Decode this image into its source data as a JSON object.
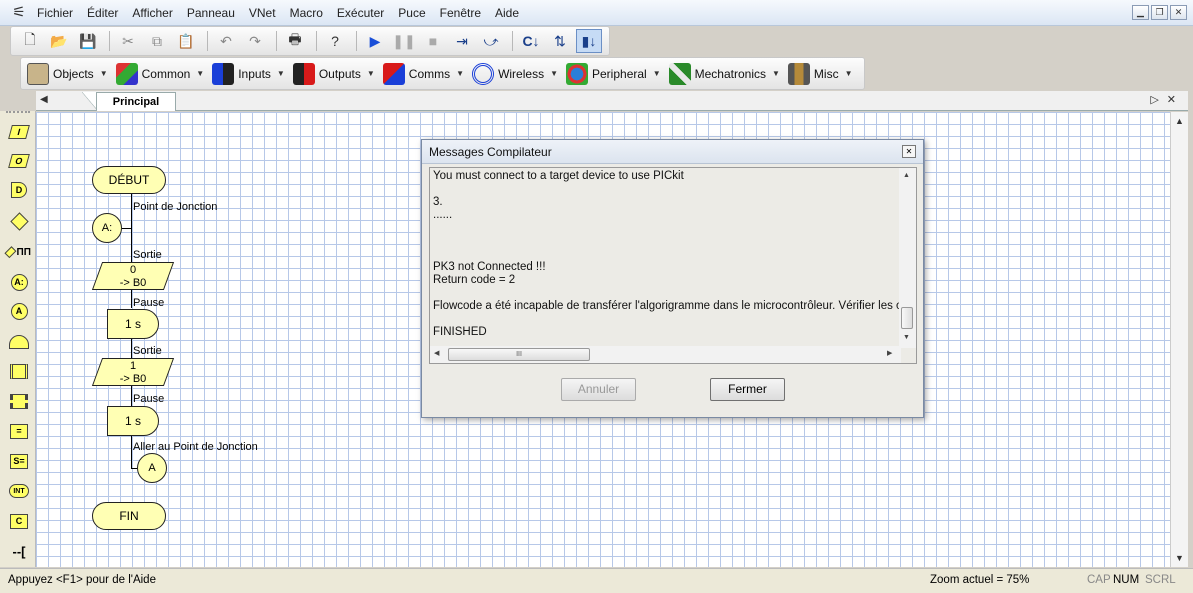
{
  "menubar": {
    "items": [
      "Fichier",
      "Éditer",
      "Afficher",
      "Panneau",
      "VNet",
      "Macro",
      "Exécuter",
      "Puce",
      "Fenêtre",
      "Aide"
    ]
  },
  "components_toolbar": {
    "groups": [
      "Objects",
      "Common",
      "Inputs",
      "Outputs",
      "Comms",
      "Wireless",
      "Peripheral",
      "Mechatronics",
      "Misc"
    ]
  },
  "tab": {
    "label": "Principal"
  },
  "flowchart": {
    "start": "DÉBUT",
    "end": "FIN",
    "junction_label": "Point de Jonction",
    "junction_name": "A:",
    "output1_label": "Sortie",
    "output1_value": "0",
    "output1_target": "-> B0",
    "pause1_label": "Pause",
    "pause1_value": "1 s",
    "output2_label": "Sortie",
    "output2_value": "1",
    "output2_target": "-> B0",
    "pause2_label": "Pause",
    "pause2_value": "1 s",
    "goto_label": "Aller au Point de Jonction",
    "goto_name": "A"
  },
  "dialog": {
    "title": "Messages Compilateur",
    "messages": "You must connect to a target device to use PICkit\n\n3.\n......\n\n\n\nPK3 not Connected !!!\nReturn code = 2\n\nFlowcode a été incapable de transférer l'algorigramme dans le microcontrôleur. Vérifier les options du\n\nFINISHED",
    "cancel_label": "Annuler",
    "close_label": "Fermer"
  },
  "statusbar": {
    "help": "Appuyez <F1> pour de l'Aide",
    "zoom": "Zoom actuel = 75%",
    "cap": "CAP",
    "num": "NUM",
    "scrl": "SCRL"
  },
  "colors": {
    "flow_fill": "#ffffb4",
    "grid": "#b7c8e8",
    "active_button": "#c6dbf5"
  },
  "icons": {
    "toolbar": [
      "new-icon",
      "open-icon",
      "save-icon",
      "cut-icon",
      "copy-icon",
      "paste-icon",
      "undo-icon",
      "redo-icon",
      "print-icon",
      "help-icon",
      "run-icon",
      "pause-icon",
      "stop-icon",
      "step-into-icon",
      "step-over-icon",
      "compile-c-icon",
      "compile-hex-icon",
      "chip-icon"
    ]
  }
}
